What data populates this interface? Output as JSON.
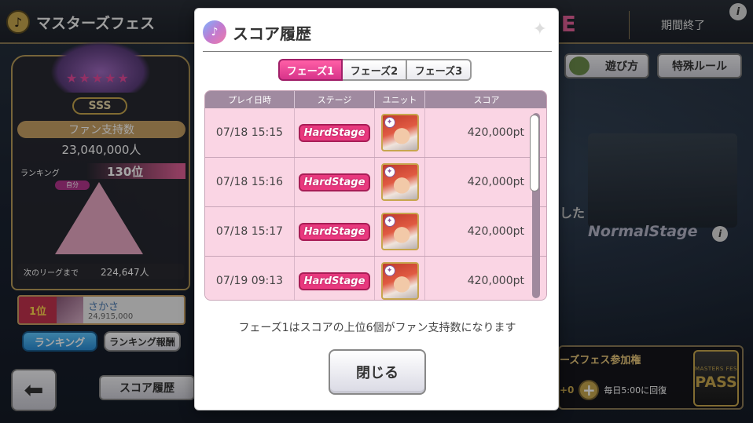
{
  "topbar": {
    "title": "マスターズフェス",
    "event_fragment": "UE",
    "status": "期間終了",
    "info_icon": "info-icon"
  },
  "left_panel": {
    "rank_grade": "SSS",
    "fan_label": "ファン支持数",
    "fan_value": "23,040,000人",
    "ranking_label": "ランキング",
    "ranking_value": "130位",
    "self_tag": "自分",
    "next_league_label": "次のリーグまで",
    "next_league_value": "224,647人",
    "player": {
      "rank": "1位",
      "name": "さかさ",
      "score": "24,915,000"
    },
    "ranking_button": "ランキング",
    "ranking_reward_button": "ランキング報酬"
  },
  "bottom_left": {
    "back_icon": "arrow-left-icon",
    "score_history_button": "スコア履歴"
  },
  "right_scene": {
    "howto_button": "遊び方",
    "special_rule_button": "特殊ルール",
    "mode_fragment": "した",
    "normal_stage": "NormalStage",
    "pass_title": "ーズフェス参加権",
    "pass_count": "+0",
    "pass_recovery": "毎日5:00に回復",
    "pass_badge_small": "MASTERS FES",
    "pass_badge_big": "PASS"
  },
  "modal": {
    "title": "スコア履歴",
    "tabs": [
      {
        "label": "フェーズ1",
        "active": true
      },
      {
        "label": "フェーズ2",
        "active": false
      },
      {
        "label": "フェーズ3",
        "active": false
      }
    ],
    "columns": {
      "date": "プレイ日時",
      "stage": "ステージ",
      "unit": "ユニット",
      "score": "スコア"
    },
    "rows": [
      {
        "date": "07/18 15:15",
        "stage": "HardStage",
        "score": "420,000pt"
      },
      {
        "date": "07/18 15:16",
        "stage": "HardStage",
        "score": "420,000pt"
      },
      {
        "date": "07/18 15:17",
        "stage": "HardStage",
        "score": "420,000pt"
      },
      {
        "date": "07/19 09:13",
        "stage": "HardStage",
        "score": "420,000pt"
      }
    ],
    "note": "フェーズ1はスコアの上位6個がファン支持数になります",
    "close_button": "閉じる"
  }
}
